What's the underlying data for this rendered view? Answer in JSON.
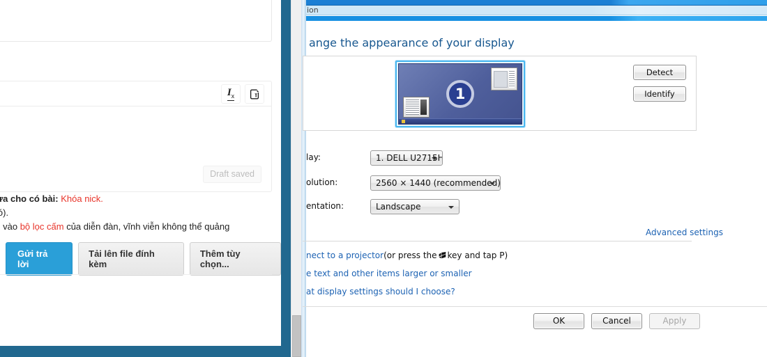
{
  "forum": {
    "editor": {
      "toolbar_buttons": [
        {
          "name": "remove-format",
          "glyph": "Ix"
        },
        {
          "name": "source-code",
          "glyph": "source"
        }
      ],
      "draft_status": "Draft saved"
    },
    "notice": {
      "line1_prefix": "ăn bừa cho có bài: ",
      "line1_link": "Khóa nick.",
      "line2": "rng có).",
      "line3_prefix": "phẩm vào ",
      "line3_link": "bộ lọc cấm",
      "line3_suffix": " của diễn đàn, vĩnh viễn không thể quảng"
    },
    "buttons": {
      "submit": "Gửi trả lời",
      "upload": "Tải lên file đính kèm",
      "more_options": "Thêm tùy chọn..."
    },
    "colors": {
      "page_background": "#21688f",
      "primary_button": "#2a9fd8",
      "link_red": "#e8342a"
    }
  },
  "display_dialog": {
    "breadcrumb": "ion",
    "heading": "ange the appearance of your display",
    "monitor_preview": {
      "number": "1"
    },
    "side_buttons": {
      "detect": "Detect",
      "identify": "Identify"
    },
    "fields": [
      {
        "label": "lay:",
        "value": "1. DELL U2715H",
        "name": "display"
      },
      {
        "label": "olution:",
        "value": "2560 × 1440 (recommended)",
        "name": "resolution"
      },
      {
        "label": "entation:",
        "value": "Landscape",
        "name": "orientation"
      }
    ],
    "advanced_settings": "Advanced settings",
    "links": {
      "projector_link": "nect to a projector",
      "projector_rest_a": "(or press the",
      "projector_rest_b": "key and tap P)",
      "text_size": "e text and other items larger or smaller",
      "which_settings": "at display settings should I choose?"
    },
    "footer_buttons": {
      "ok": "OK",
      "cancel": "Cancel",
      "apply": "Apply"
    },
    "colors": {
      "heading": "#17578f",
      "link": "#1c62b3",
      "monitor_border": "#49b7f0"
    }
  }
}
